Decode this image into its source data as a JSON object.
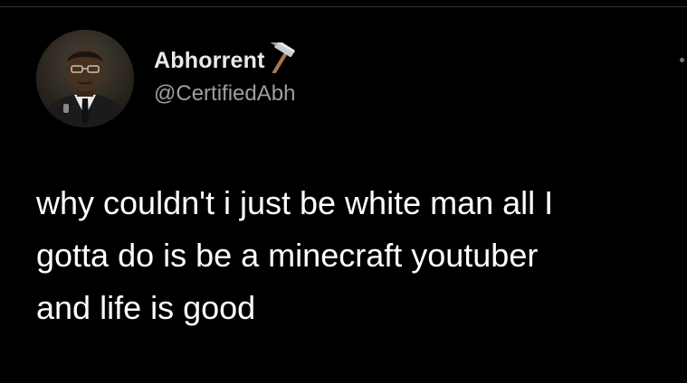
{
  "tweet": {
    "display_name": "Abhorrent",
    "handle": "@CertifiedAbh",
    "display_name_icon": "hammer-icon",
    "avatar": "avatar-man-in-suit",
    "text": "why couldn't i just be white man all I\ngotta do is be a minecraft youtuber\nand life is good"
  },
  "colors": {
    "background": "#000000",
    "primary_text": "#e7e9ea",
    "secondary_text": "#9a9fa4"
  }
}
